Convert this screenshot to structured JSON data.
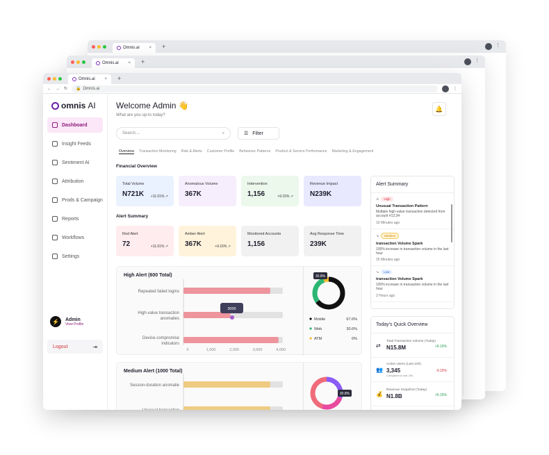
{
  "browser": {
    "tab_title": "Omnis.ai",
    "url": "Omnis.ai",
    "new_tab": "+"
  },
  "brand": {
    "name": "omnis",
    "suffix": "AI"
  },
  "sidebar": {
    "items": [
      {
        "label": "Dashboard",
        "icon": "grid-icon",
        "active": true
      },
      {
        "label": "Insight Feeds",
        "icon": "feed-icon"
      },
      {
        "label": "Sentiment AI",
        "icon": "sentiment-icon"
      },
      {
        "label": "Attribution",
        "icon": "target-icon"
      },
      {
        "label": "Prods & Campaigns",
        "icon": "box-icon"
      },
      {
        "label": "Reports",
        "icon": "report-icon"
      },
      {
        "label": "Workflows",
        "icon": "workflow-icon"
      },
      {
        "label": "Settings",
        "icon": "gear-icon"
      }
    ]
  },
  "user": {
    "name": "Admin",
    "link": "View Profile",
    "initial": "⚡"
  },
  "logout": {
    "label": "Logout"
  },
  "header": {
    "welcome": "Welcome Admin 👋",
    "subtitle": "What are you up-to today?"
  },
  "search": {
    "placeholder": "Search...."
  },
  "filter": {
    "label": "Filter"
  },
  "tabs": [
    "Overview",
    "Transaction Monitoring",
    "Risk & Alerts",
    "Customer Profile",
    "Behaviour Patterns",
    "Product & Service Performance",
    "Marketing & Engagement"
  ],
  "financial": {
    "title": "Financial Overview",
    "cards": [
      {
        "label": "Total Volume",
        "value": "N721K",
        "change": "+11.01%"
      },
      {
        "label": "Anomalous Volume",
        "value": "367K",
        "change": ""
      },
      {
        "label": "Intervention",
        "value": "1,156",
        "change": "+9.15%"
      },
      {
        "label": "Revenue Impact",
        "value": "N239K",
        "change": ""
      }
    ]
  },
  "alert_summary_cards": {
    "title": "Alert Summary",
    "cards": [
      {
        "label": "Red Alert",
        "value": "72",
        "change": "+11.01%"
      },
      {
        "label": "Amber Alert",
        "value": "367K",
        "change": "+9.15%"
      },
      {
        "label": "Monitored Accounts",
        "value": "1,156",
        "change": ""
      },
      {
        "label": "Avg Response Time",
        "value": "239K",
        "change": ""
      }
    ]
  },
  "high_alert": {
    "title": "High Alert (600 Total)",
    "tooltip": "3000",
    "donut_label": "30.8%",
    "legend": [
      {
        "name": "Mobile",
        "value": "67.6%",
        "color": "#111111"
      },
      {
        "name": "Web",
        "value": "30.6%",
        "color": "#2bb673"
      },
      {
        "name": "ATM",
        "value": "6%",
        "color": "#f5b82e"
      }
    ]
  },
  "medium_alert": {
    "title": "Medium Alert (1000 Total)",
    "donut_label": "30.8%"
  },
  "chart_data": [
    {
      "type": "bar",
      "categories": [
        "Repeated failed logins",
        "High-value transaction anomalies",
        "Device-compromise indicators"
      ],
      "values": [
        3700,
        2000,
        4050
      ],
      "ticks": [
        "0",
        "1,000",
        "2,000",
        "3,000",
        "4,000"
      ],
      "xlim": [
        0,
        4000
      ]
    },
    {
      "type": "pie",
      "labels": [
        "Mobile",
        "Web",
        "ATM"
      ],
      "values": [
        67.6,
        30.6,
        6
      ]
    },
    {
      "type": "bar",
      "categories": [
        "Session-duration anomalie",
        "Unusual transaction"
      ],
      "values": [
        3700,
        3700
      ]
    }
  ],
  "alert_panel": {
    "title": "Alert Summary",
    "items": [
      {
        "badge": "High",
        "title": "Unusual Transaction Pattern",
        "desc": "Multiple high-value transaction detected from account #12;34",
        "time": "10 Minutes ago"
      },
      {
        "badge": "Medium",
        "title": "transaction Volume Spark",
        "desc": "100% increase in transaction volume in the last hour",
        "time": "25 Minutes ago"
      },
      {
        "badge": "Low",
        "title": "transaction Volume Spark",
        "desc": "100% increase in transaction volume in the last hour",
        "time": "2 Hours ago"
      }
    ]
  },
  "quick": {
    "title": "Today's Quick Overview",
    "items": [
      {
        "label": "Total Transaction Volume (Today)",
        "value": "N15.8M",
        "change": "+9.15%",
        "dir": "up",
        "compared": ""
      },
      {
        "label": "Active Users (Last 24h)",
        "value": "3,345",
        "change": "-9.15%",
        "dir": "down",
        "compared": "Compared to last 24h"
      },
      {
        "label": "Revenue Snapshot (Today)",
        "value": "N1.8B",
        "change": "+9.15%",
        "dir": "up",
        "compared": ""
      }
    ]
  },
  "colors": {
    "accent": "#8a1a7a",
    "brand": "#6a1fa8",
    "bar_red": "#f07a85",
    "bar_amber": "#f5c25a"
  }
}
